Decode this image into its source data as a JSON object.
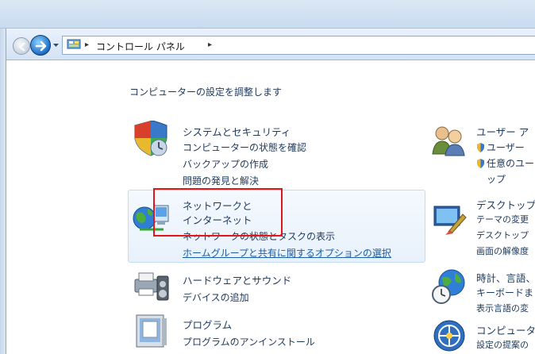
{
  "breadcrumb": {
    "path": "コントロール パネル",
    "separator": "▸"
  },
  "page_title": "コンピューターの設定を調整します",
  "categories_left": [
    {
      "title": "システムとセキュリティ",
      "icon": "shield-icon",
      "links": [
        "コンピューターの状態を確認",
        "バックアップの作成",
        "問題の発見と解決"
      ]
    },
    {
      "title": "ネットワークと",
      "title2": "インターネット",
      "icon": "network-globe-icon",
      "links": [
        "ネットワークの状態とタスクの表示",
        "ホームグループと共有に関するオプションの選択"
      ]
    },
    {
      "title": "ハードウェアとサウンド",
      "icon": "printer-speaker-icon",
      "links": [
        "デバイスの追加"
      ]
    },
    {
      "title": "プログラム",
      "icon": "programs-box-icon",
      "links": [
        "プログラムのアンインストール"
      ]
    }
  ],
  "categories_right": [
    {
      "title": "ユーザー ア",
      "icon": "users-icon",
      "links": [
        "ユーザー",
        "任意のユー",
        "ップ"
      ]
    },
    {
      "title": "デスクトップ",
      "icon": "desktop-paint-icon",
      "links": [
        "テーマの変更",
        "デスクトップ",
        "画面の解像度"
      ]
    },
    {
      "title": "時計、言語、",
      "icon": "globe-clock-icon",
      "links": [
        "キーボードま",
        "表示言語の変"
      ]
    },
    {
      "title": "コンピュータ",
      "icon": "ease-of-access-icon",
      "links": [
        "設定の提案の"
      ]
    }
  ],
  "colors": {
    "highlight_box": "#e0161b",
    "link": "#1e395b",
    "underline_link": "#1c5da9"
  }
}
